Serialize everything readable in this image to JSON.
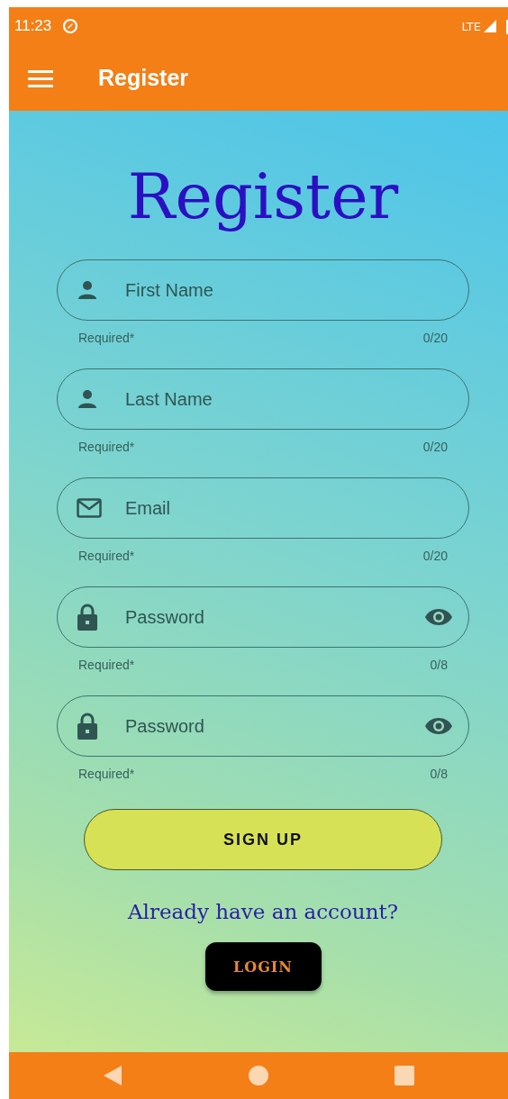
{
  "status_bar": {
    "time": "11:23",
    "network": "LTE"
  },
  "app_bar": {
    "title": "Register"
  },
  "heading": "Register",
  "fields": [
    {
      "kind": "person",
      "placeholder": "First Name",
      "helper": "Required*",
      "counter": "0/20"
    },
    {
      "kind": "person",
      "placeholder": "Last Name",
      "helper": "Required*",
      "counter": "0/20"
    },
    {
      "kind": "email",
      "placeholder": "Email",
      "helper": "Required*",
      "counter": "0/20"
    },
    {
      "kind": "password",
      "placeholder": "Password",
      "helper": "Required*",
      "counter": "0/8"
    },
    {
      "kind": "password",
      "placeholder": "Password",
      "helper": "Required*",
      "counter": "0/8"
    }
  ],
  "signup_button": "SIGN UP",
  "login_prompt": "Already have an account?",
  "login_button": "LOGIN"
}
